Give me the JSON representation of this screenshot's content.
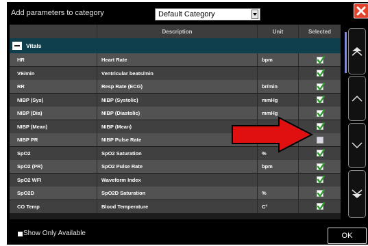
{
  "dialog": {
    "title": "Add parameters to category",
    "category_select": "Default Category",
    "ok_label": "OK",
    "show_only_label": "Show Only Available"
  },
  "table": {
    "headers": {
      "name": "",
      "description": "Description",
      "unit": "Unit",
      "selected": "Selected"
    },
    "group": "Vitals",
    "rows": [
      {
        "name": "HR",
        "description": "Heart Rate",
        "unit": "bpm",
        "selected": true
      },
      {
        "name": "VE/min",
        "description": "Ventricular beats/min",
        "unit": "",
        "selected": true
      },
      {
        "name": "RR",
        "description": "Resp Rate (ECG)",
        "unit": "br/min",
        "selected": true
      },
      {
        "name": "NIBP (Sys)",
        "description": "NIBP (Systolic)",
        "unit": "mmHg",
        "selected": true
      },
      {
        "name": "NIBP (Dia)",
        "description": "NIBP (Diastolic)",
        "unit": "mmHg",
        "selected": true
      },
      {
        "name": "NIBP (Mean)",
        "description": "NIBP (Mean)",
        "unit": "",
        "selected": true
      },
      {
        "name": "NIBP PR",
        "description": "NIBP Pulse Rate",
        "unit": "bpm",
        "selected": false
      },
      {
        "name": "SpO2",
        "description": "SpO2 Saturation",
        "unit": "%",
        "selected": true
      },
      {
        "name": "SpO2 (PR)",
        "description": "SpO2 Pulse Rate",
        "unit": "bpm",
        "selected": true
      },
      {
        "name": "SpO2 WFI",
        "description": "Waveform Index",
        "unit": "",
        "selected": true
      },
      {
        "name": "SpO2D",
        "description": "SpO2D Saturation",
        "unit": "%",
        "selected": true
      },
      {
        "name": "CO Temp",
        "description": "Blood Temperature",
        "unit": "C°",
        "selected": true
      }
    ]
  },
  "icons": {
    "close": "close-icon",
    "dropdown": "dropdown-arrow-icon",
    "scroll_top": "double-chevron-up-icon",
    "scroll_up": "chevron-up-icon",
    "scroll_down": "chevron-down-icon",
    "scroll_bottom": "double-chevron-down-icon",
    "collapse": "collapse-minus-icon",
    "check": "checkmark-icon"
  },
  "colors": {
    "close_button": "#e2442b",
    "group_row": "#0f3f4d",
    "check_green": "#2e9a2e",
    "annotation_arrow": "#e01010",
    "scroll_thumb": "#7a8be0"
  }
}
